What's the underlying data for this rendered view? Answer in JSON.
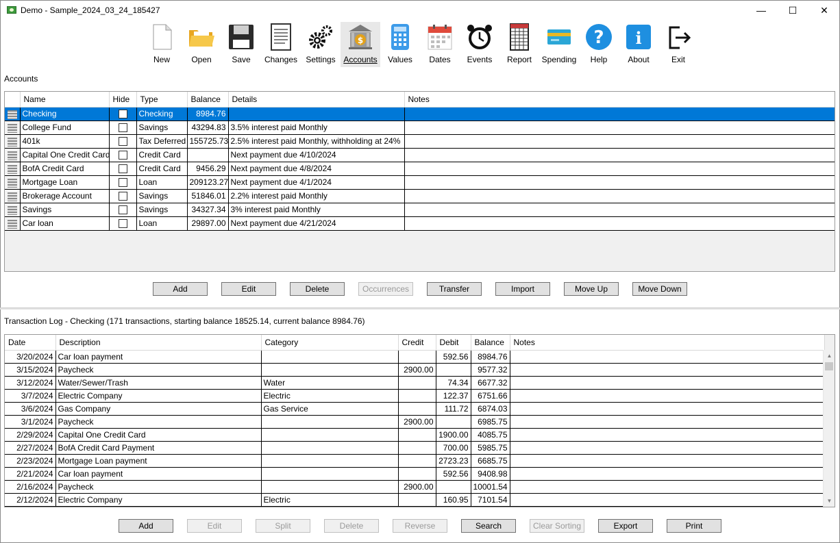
{
  "window": {
    "title": "Demo - Sample_2024_03_24_185427",
    "minimize": "—",
    "maximize": "☐",
    "close": "✕"
  },
  "toolbar": {
    "new": "New",
    "open": "Open",
    "save": "Save",
    "changes": "Changes",
    "settings": "Settings",
    "accounts": "Accounts",
    "values": "Values",
    "dates": "Dates",
    "events": "Events",
    "report": "Report",
    "spending": "Spending",
    "help": "Help",
    "about": "About",
    "exit": "Exit"
  },
  "accounts": {
    "section_title": "Accounts",
    "columns": {
      "name": "Name",
      "hide": "Hide",
      "type": "Type",
      "balance": "Balance",
      "details": "Details",
      "notes": "Notes"
    },
    "rows": [
      {
        "name": "Checking",
        "type": "Checking",
        "balance": "8984.76",
        "details": "",
        "notes": ""
      },
      {
        "name": "College Fund",
        "type": "Savings",
        "balance": "43294.83",
        "details": "3.5% interest paid Monthly",
        "notes": ""
      },
      {
        "name": "401k",
        "type": "Tax Deferred",
        "balance": "155725.73",
        "details": "2.5% interest paid Monthly, withholding at 24%",
        "notes": ""
      },
      {
        "name": "Capital One Credit Card",
        "type": "Credit Card",
        "balance": "",
        "details": "Next payment due 4/10/2024",
        "notes": ""
      },
      {
        "name": "BofA Credit Card",
        "type": "Credit Card",
        "balance": "9456.29",
        "details": "Next payment due 4/8/2024",
        "notes": ""
      },
      {
        "name": "Mortgage Loan",
        "type": "Loan",
        "balance": "209123.27",
        "details": "Next payment due 4/1/2024",
        "notes": ""
      },
      {
        "name": "Brokerage Account",
        "type": "Savings",
        "balance": "51846.01",
        "details": "2.2% interest paid Monthly",
        "notes": ""
      },
      {
        "name": "Savings",
        "type": "Savings",
        "balance": "34327.34",
        "details": "3% interest paid Monthly",
        "notes": ""
      },
      {
        "name": "Car loan",
        "type": "Loan",
        "balance": "29897.00",
        "details": "Next payment due 4/21/2024",
        "notes": ""
      }
    ],
    "buttons": {
      "add": "Add",
      "edit": "Edit",
      "delete": "Delete",
      "occurrences": "Occurrences",
      "transfer": "Transfer",
      "import": "Import",
      "move_up": "Move Up",
      "move_down": "Move Down"
    }
  },
  "transactions": {
    "section_title": "Transaction Log - Checking (171 transactions, starting balance 18525.14, current balance 8984.76)",
    "columns": {
      "date": "Date",
      "description": "Description",
      "category": "Category",
      "credit": "Credit",
      "debit": "Debit",
      "balance": "Balance",
      "notes": "Notes"
    },
    "rows": [
      {
        "date": "3/20/2024",
        "description": "Car loan payment",
        "category": "",
        "credit": "",
        "debit": "592.56",
        "balance": "8984.76",
        "notes": ""
      },
      {
        "date": "3/15/2024",
        "description": "Paycheck",
        "category": "",
        "credit": "2900.00",
        "debit": "",
        "balance": "9577.32",
        "notes": ""
      },
      {
        "date": "3/12/2024",
        "description": "Water/Sewer/Trash",
        "category": "Water",
        "credit": "",
        "debit": "74.34",
        "balance": "6677.32",
        "notes": ""
      },
      {
        "date": "3/7/2024",
        "description": "Electric Company",
        "category": "Electric",
        "credit": "",
        "debit": "122.37",
        "balance": "6751.66",
        "notes": ""
      },
      {
        "date": "3/6/2024",
        "description": "Gas Company",
        "category": "Gas Service",
        "credit": "",
        "debit": "111.72",
        "balance": "6874.03",
        "notes": ""
      },
      {
        "date": "3/1/2024",
        "description": "Paycheck",
        "category": "",
        "credit": "2900.00",
        "debit": "",
        "balance": "6985.75",
        "notes": ""
      },
      {
        "date": "2/29/2024",
        "description": "Capital One Credit Card",
        "category": "",
        "credit": "",
        "debit": "1900.00",
        "balance": "4085.75",
        "notes": ""
      },
      {
        "date": "2/27/2024",
        "description": "BofA Credit Card Payment",
        "category": "",
        "credit": "",
        "debit": "700.00",
        "balance": "5985.75",
        "notes": ""
      },
      {
        "date": "2/23/2024",
        "description": "Mortgage Loan payment",
        "category": "",
        "credit": "",
        "debit": "2723.23",
        "balance": "6685.75",
        "notes": ""
      },
      {
        "date": "2/21/2024",
        "description": "Car loan payment",
        "category": "",
        "credit": "",
        "debit": "592.56",
        "balance": "9408.98",
        "notes": ""
      },
      {
        "date": "2/16/2024",
        "description": "Paycheck",
        "category": "",
        "credit": "2900.00",
        "debit": "",
        "balance": "10001.54",
        "notes": ""
      },
      {
        "date": "2/12/2024",
        "description": "Electric Company",
        "category": "Electric",
        "credit": "",
        "debit": "160.95",
        "balance": "7101.54",
        "notes": ""
      }
    ],
    "buttons": {
      "add": "Add",
      "edit": "Edit",
      "split": "Split",
      "delete": "Delete",
      "reverse": "Reverse",
      "search": "Search",
      "clear_sorting": "Clear Sorting",
      "export": "Export",
      "print": "Print"
    }
  },
  "colors": {
    "selection": "#0078d7",
    "accent_help": "#1e8fe0",
    "accent_about": "#1e8fe0"
  },
  "icons": [
    "new-icon",
    "open-icon",
    "save-icon",
    "changes-icon",
    "settings-icon",
    "accounts-icon",
    "values-icon",
    "dates-icon",
    "events-icon",
    "report-icon",
    "spending-icon",
    "help-icon",
    "about-icon",
    "exit-icon"
  ]
}
